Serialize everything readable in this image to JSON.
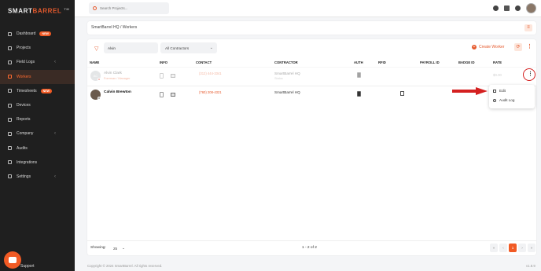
{
  "brand": {
    "part1": "SMART",
    "part2": "BARREL",
    "suffix": "TM"
  },
  "sidebar": {
    "items": [
      {
        "label": "Dashboard",
        "badge": "NEW",
        "icon": "dashboard-icon"
      },
      {
        "label": "Projects",
        "icon": "projects-icon"
      },
      {
        "label": "Field Logs",
        "icon": "field-logs-icon",
        "chevron": "‹"
      },
      {
        "label": "Workers",
        "icon": "workers-icon",
        "active": true
      },
      {
        "label": "Timesheets",
        "badge": "NEW",
        "icon": "timesheets-icon"
      },
      {
        "label": "Devices",
        "icon": "devices-icon"
      },
      {
        "label": "Reports",
        "icon": "reports-icon"
      },
      {
        "label": "Company",
        "icon": "company-icon",
        "chevron": "‹"
      },
      {
        "label": "Audits",
        "icon": "audits-icon"
      },
      {
        "label": "Integrations",
        "icon": "integrations-icon"
      },
      {
        "label": "Settings",
        "icon": "settings-icon",
        "chevron": "‹"
      }
    ],
    "support_label": "Support"
  },
  "topbar": {
    "search_placeholder": "Search Projects..."
  },
  "breadcrumb": {
    "text": "SmartBarrel HQ  /  Workers"
  },
  "filters": {
    "name_value": "Alvin",
    "contractor_value": "All Contractors",
    "create_label": "Create Worker"
  },
  "table": {
    "headers": [
      "NAME",
      "INFO",
      "CONTACT",
      "CONTRACTOR",
      "AUTH",
      "RFID",
      "PAYROLL ID",
      "BADGE ID",
      "RATE"
    ],
    "rows": [
      {
        "initials": "AC",
        "name": "Alvin Clark",
        "sub": "Foreman / Manager",
        "phone": "(312) 444-3341",
        "contractor": "SmartBarrel HQ",
        "contractor_sub": "Status",
        "rate": "$0.00"
      },
      {
        "initials": "",
        "name": "Calvin Brewton",
        "sub": "",
        "phone": "(760) 208-4321",
        "contractor": "SmartBarrel HQ",
        "contractor_sub": "",
        "rate": ""
      }
    ]
  },
  "row_menu": {
    "edit": "Edit",
    "audit": "Audit Log"
  },
  "footer": {
    "showing_label": "Showing:",
    "per_page": "25",
    "range": "1 - 2 of 2",
    "pages": [
      "«",
      "‹",
      "1",
      "›",
      "»"
    ],
    "current_page": "1"
  },
  "copyright": "Copyright © 2024 SmartBarrel. All rights reserved.",
  "version": "v1.8.9",
  "colors": {
    "accent": "#f15a24",
    "sidebar_bg": "#1f1f1f",
    "annotation_red": "#d42020"
  }
}
